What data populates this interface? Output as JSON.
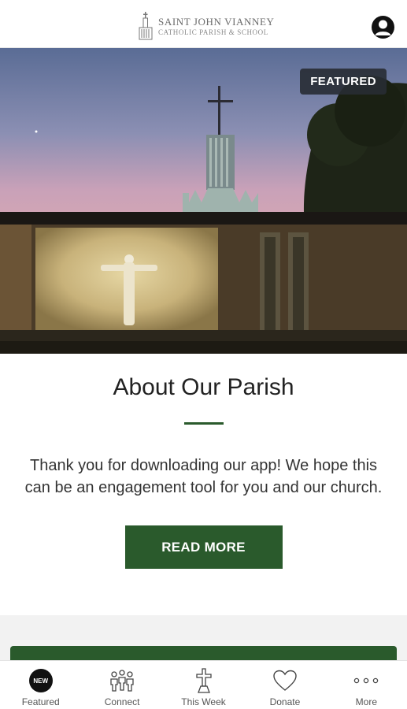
{
  "header": {
    "logo_line1": "SAINT JOHN VIANNEY",
    "logo_line2": "CATHOLIC PARISH & SCHOOL",
    "profile_icon": "user-circle-icon"
  },
  "hero": {
    "badge": "FEATURED",
    "image": "church-exterior-at-dusk-with-crucifix"
  },
  "feature": {
    "title": "About Our Parish",
    "body": "Thank you for downloading our app! We hope this can be an engagement tool for you and our church.",
    "button": "READ MORE"
  },
  "colors": {
    "accent": "#2a5a2c",
    "badge_bg": "#2c3038"
  },
  "tabs": [
    {
      "label": "Featured",
      "icon": "new-badge-icon",
      "badge": "NEW"
    },
    {
      "label": "Connect",
      "icon": "people-group-icon"
    },
    {
      "label": "This Week",
      "icon": "cross-icon"
    },
    {
      "label": "Donate",
      "icon": "heart-icon"
    },
    {
      "label": "More",
      "icon": "more-dots-icon"
    }
  ]
}
